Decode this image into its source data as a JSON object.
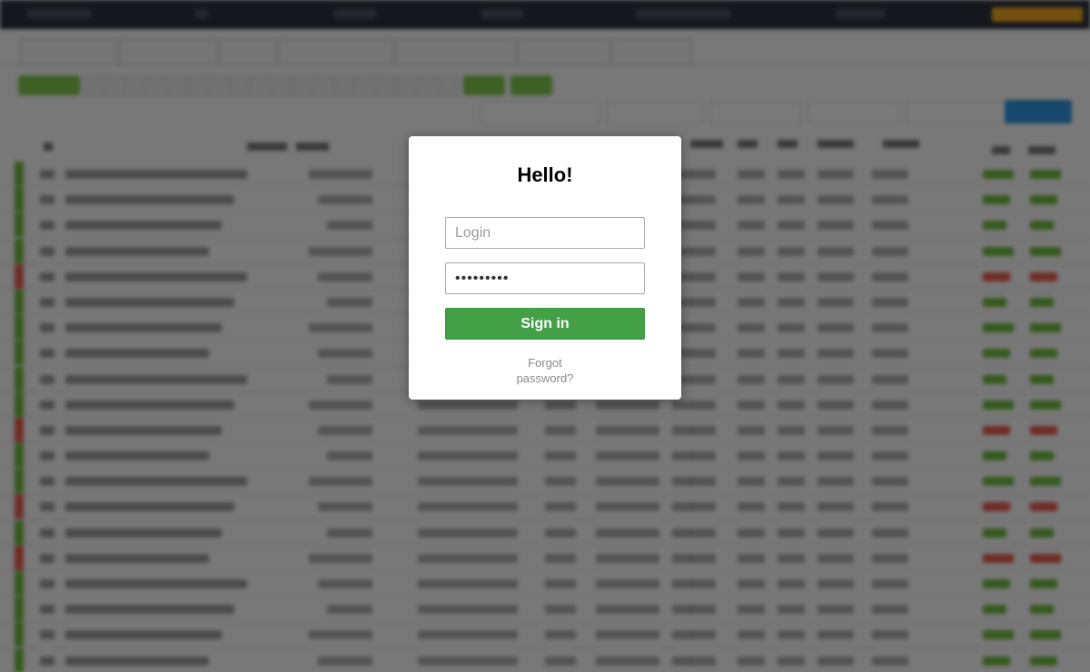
{
  "login_modal": {
    "title": "Hello!",
    "login_placeholder": "Login",
    "password_value": "•••••••••",
    "signin_label": "Sign in",
    "forgot_line1": "Forgot",
    "forgot_line2": "password?"
  },
  "colors": {
    "signin_green": "#43a047",
    "overlay": "rgba(0,0,0,0.5)",
    "topbar": "#2b2f3a",
    "accent_orange": "#e6a21f",
    "apply_blue": "#2f8fd8",
    "positive_green": "#6cb33f",
    "negative_red": "#e05a4f"
  }
}
